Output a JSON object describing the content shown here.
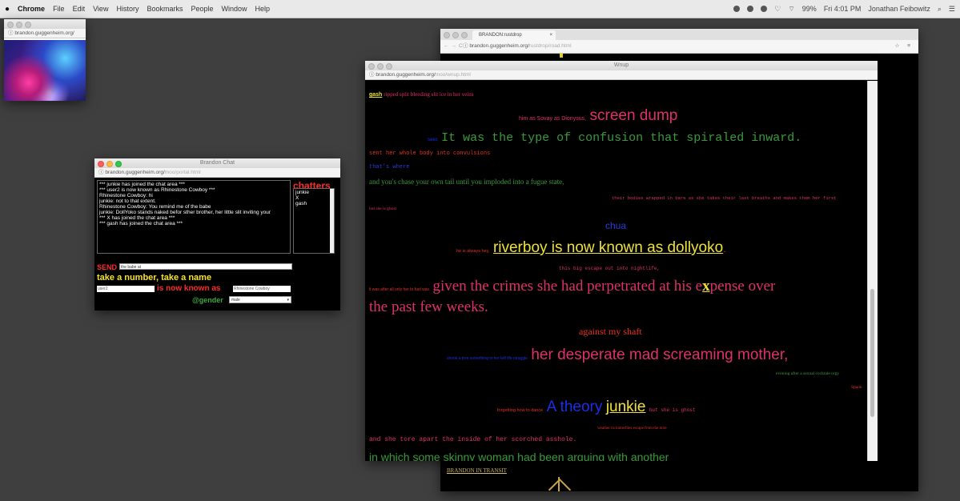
{
  "menubar": {
    "app": "Chrome",
    "menus": [
      "File",
      "Edit",
      "View",
      "History",
      "Bookmarks",
      "People",
      "Window",
      "Help"
    ],
    "battery": "99%",
    "clock": "Fri 4:01 PM",
    "user": "Jonathan Feibowitz"
  },
  "image_window": {
    "url": "brandon.guggenheim.org/"
  },
  "chat_window": {
    "title": "Brandon Chat",
    "url": "brandon.guggenheim.org/",
    "url_dim": "moo/portal.html",
    "log": [
      "*** junkie has joined the chat area ***",
      "*** user2 is now known as Rhinestone Cowboy ***",
      "Rhinestone Cowboy: hi",
      "junkie: not to that extent.",
      "Rhinestone Cowboy: You remind me of the babe",
      "junkie: DollYoko stands naked befor sther brother, her little slit inviting your",
      "*** X has joined the chat area ***",
      "*** gash has joined the chat area ***"
    ],
    "chatters_label": "chatters",
    "chatters": [
      "junkie",
      "X",
      "gash"
    ],
    "send_label": "SEND",
    "send_value": "the babe at",
    "take_name_label": "take a number, take a name",
    "name_from": "user2",
    "known_as_label": "is now known as",
    "name_to": "Rhinestone Cowboy",
    "gender_label": "@gender",
    "gender_value": "male"
  },
  "back_browser": {
    "tab_title": "BRANDON:rustdrop",
    "url": "brandon.guggenheim.org/",
    "url_dim": "rustdrop/road.html",
    "link": "BRANDON IN TRANSIT"
  },
  "poem_window": {
    "title": "Wnup",
    "url": "brandon.guggenheim.org/",
    "url_dim": "moo/wnup.html",
    "lines": {
      "l1": "gash",
      "l1b": "ripped split bleeding slit ice in her veins",
      "l2a": "him as Sovay as Dionysus,",
      "l2b": "screen dump",
      "l3a": "sees",
      "l3b": "It was the type of confusion that spiraled inward.",
      "l4": "sent her whole body into convulsions",
      "l5": "that's where",
      "l6": "and you's chase your own tail until you imploded into a fugue state,",
      "l7": "their bodies wrapped in bare as she takes their last breaths and makes them her first",
      "l8": "but she is ghost",
      "l9": "chua",
      "l10a": "he is always hey,",
      "l10b": "riverboy is now known as dollyoko",
      "l11": "this big escape out into nightlife,",
      "l12a": "it was after all only her to fuel was",
      "l12b": "given the crimes she had perpetrated at his e",
      "l12x": "x",
      "l12c": "pense over",
      "l12d": "the past few weeks.",
      "l13": "against my shaft",
      "l14a": "shook a tree something in her left life struggle",
      "l14b": "her desperate mad screaming mother,",
      "l15": "evening after a sexual cocktale orgy",
      "l16": "Spank",
      "l17a": "forgetting how to dance",
      "l17b": "A theory",
      "l17c": "junkie",
      "l17d": "but she is ghost",
      "l18": "weather its butterflies escape from the mire",
      "l19": "and she tore apart the inside of her scorched asshole.",
      "l20": "in which some skinny woman had been arguing with another"
    }
  }
}
